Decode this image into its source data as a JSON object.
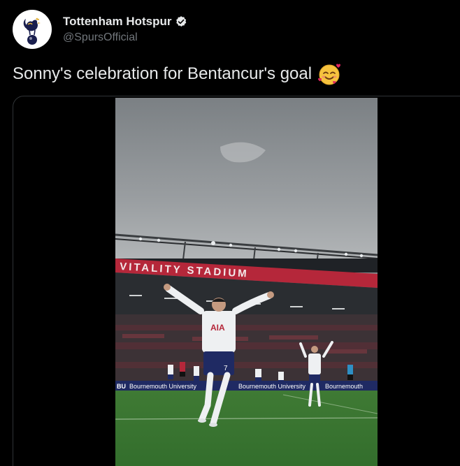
{
  "author": {
    "display_name": "Tottenham Hotspur",
    "handle": "@SpursOfficial",
    "verified": true,
    "avatar_icon": "cockerel-crest-icon"
  },
  "tweet": {
    "text": "Sonny's celebration for Bentancur's goal",
    "emoji": "smiling-face-with-hearts"
  },
  "media": {
    "type": "video",
    "stadium_banner": "VITALITY STADIUM",
    "board_text_1": "Bournemouth University",
    "board_text_2": "Bournemouth",
    "board_prefix": "BU",
    "shirt_sponsor": "AIA",
    "shirt_number": "7"
  },
  "colors": {
    "background": "#000000",
    "text_primary": "#e7e9ea",
    "text_secondary": "#71767b",
    "verified_badge": "#e7e9ea",
    "banner_red": "#b5273a"
  }
}
